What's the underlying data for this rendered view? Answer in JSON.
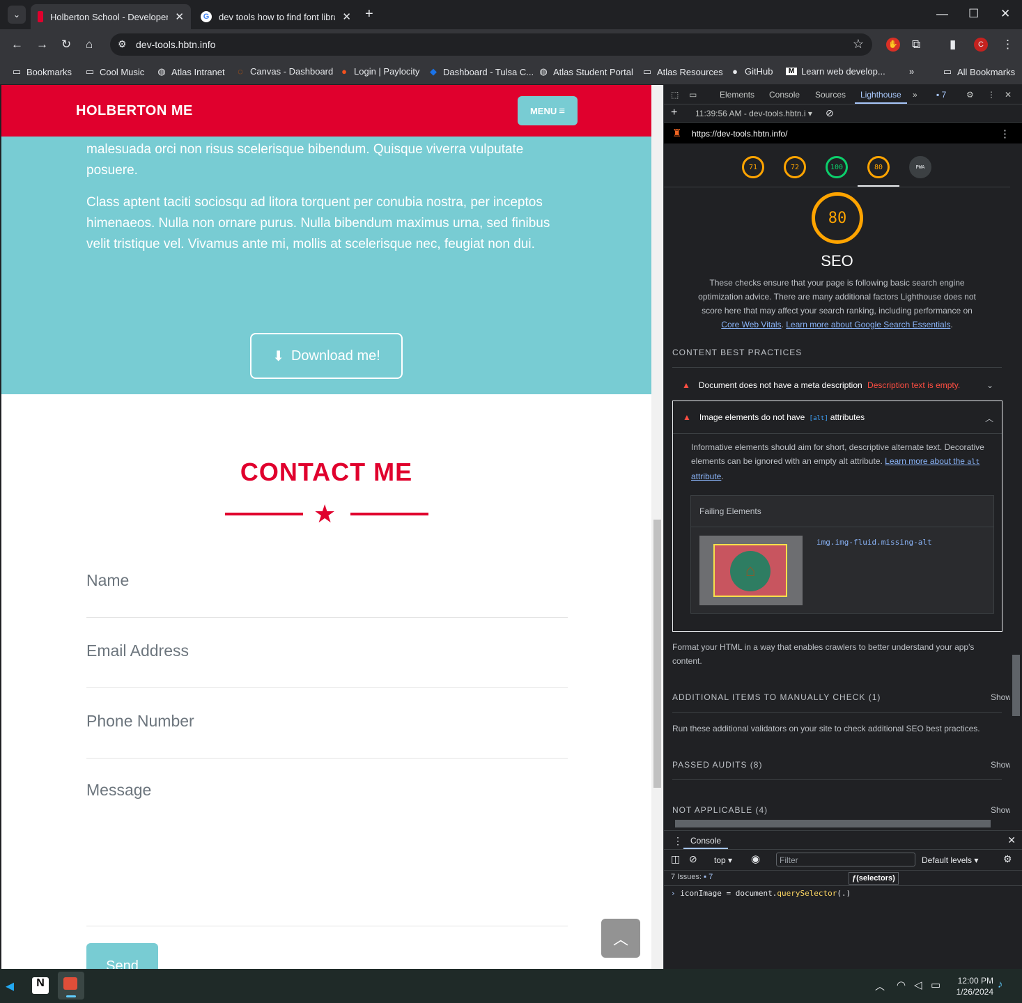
{
  "browser": {
    "tabs": [
      {
        "title": "Holberton School - Developer t",
        "active": true
      },
      {
        "title": "dev tools how to find font librar",
        "active": false
      }
    ],
    "url": "dev-tools.hbtn.info",
    "bookmarks": [
      "Bookmarks",
      "Cool Music",
      "Atlas Intranet",
      "Canvas - Dashboard",
      "Login | Paylocity",
      "Dashboard - Tulsa C...",
      "Atlas Student Portal",
      "Atlas Resources",
      "GitHub",
      "Learn web develop...",
      "All Bookmarks"
    ],
    "profile_initial": "C"
  },
  "page": {
    "brand": "HOLBERTON ME",
    "menu_label": "MENU",
    "para1": "malesuada orci non risus scelerisque bibendum. Quisque viverra vulputate posuere.",
    "para2": "Class aptent taciti sociosqu ad litora torquent per conubia nostra, per inceptos himenaeos. Nulla non ornare purus. Nulla bibendum maximus urna, sed finibus velit tristique vel. Vivamus ante mi, mollis at scelerisque nec, feugiat non dui.",
    "download_label": "Download me!",
    "contact_title": "CONTACT ME",
    "fields": {
      "name": "Name",
      "email": "Email Address",
      "phone": "Phone Number",
      "message": "Message"
    },
    "send_label": "Send"
  },
  "devtools": {
    "tabs": [
      "Elements",
      "Console",
      "Sources",
      "Lighthouse"
    ],
    "issues_badge": "7",
    "report_time": "11:39:56 AM - dev-tools.hbtn.i",
    "report_url": "https://dev-tools.hbtn.info/",
    "scores": [
      "71",
      "72",
      "100",
      "80"
    ],
    "pwa_label": "PWA",
    "big_score": "80",
    "category": "SEO",
    "description": "These checks ensure that your page is following basic search engine optimization advice. There are many additional factors Lighthouse does not score here that may affect your search ranking, including performance on",
    "link_cwv": "Core Web Vitals",
    "link_learn": "Learn more about Google Search Essentials",
    "section_content": "CONTENT BEST PRACTICES",
    "audit1_title": "Document does not have a meta description",
    "audit1_detail": "Description text is empty.",
    "audit2_title_a": "Image elements do not have",
    "audit2_code": "[alt]",
    "audit2_title_b": "attributes",
    "audit2_desc": "Informative elements should aim for short, descriptive alternate text. Decorative elements can be ignored with an empty alt attribute.",
    "audit2_link_a": "Learn more about the",
    "audit2_link_code": "alt",
    "audit2_link_b": "attribute",
    "failing_label": "Failing Elements",
    "failing_selector": "img.img-fluid.missing-alt",
    "format_text": "Format your HTML in a way that enables crawlers to better understand your app's content.",
    "section_manual": "ADDITIONAL ITEMS TO MANUALLY CHECK (1)",
    "manual_text": "Run these additional validators on your site to check additional SEO best practices.",
    "section_passed": "PASSED AUDITS (8)",
    "section_na": "NOT APPLICABLE (4)",
    "show_label": "Show",
    "console": {
      "tab": "Console",
      "context": "top",
      "filter_placeholder": "Filter",
      "levels": "Default levels",
      "issues_label": "7 Issues:",
      "issues_count": "7",
      "tooltip": "ƒ(selectors)",
      "input_a": "iconImage = document.",
      "input_method": "querySelector",
      "input_b": "(.)"
    }
  },
  "taskbar": {
    "time": "12:00 PM",
    "date": "1/26/2024"
  },
  "colors": {
    "accent_red": "#e0002d",
    "teal": "#78ccd3",
    "lighthouse_orange": "#ffa400",
    "lighthouse_green": "#0cce6b"
  }
}
